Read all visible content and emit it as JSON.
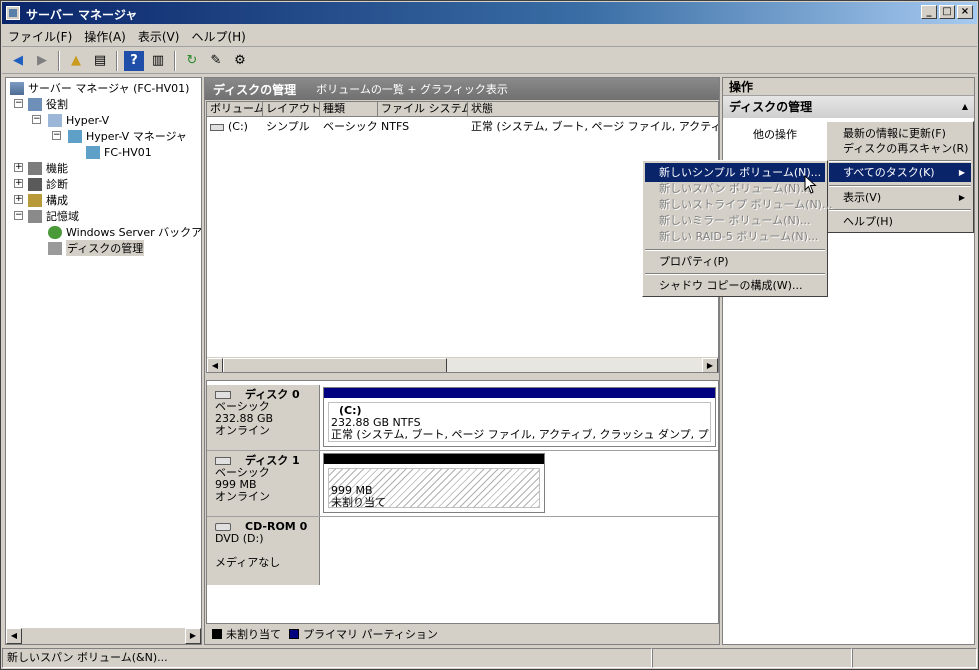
{
  "window": {
    "title": "サーバー マネージャ",
    "min": "_",
    "max": "□",
    "close": "×"
  },
  "menu": [
    "ファイル(F)",
    "操作(A)",
    "表示(V)",
    "ヘルプ(H)"
  ],
  "tree": {
    "items": [
      {
        "label": "サーバー マネージャ (FC-HV01)"
      },
      {
        "label": "役割"
      },
      {
        "label": "Hyper-V"
      },
      {
        "label": "Hyper-V マネージャ"
      },
      {
        "label": "FC-HV01"
      },
      {
        "label": "機能"
      },
      {
        "label": "診断"
      },
      {
        "label": "構成"
      },
      {
        "label": "記憶域"
      },
      {
        "label": "Windows Server バックアップ"
      },
      {
        "label": "ディスクの管理"
      }
    ]
  },
  "center": {
    "title": "ディスクの管理",
    "subtitle": "ボリュームの一覧 + グラフィック表示",
    "columns": [
      "ボリューム",
      "レイアウト",
      "種類",
      "ファイル システム",
      "状態"
    ],
    "rows": [
      {
        "volume": "(C:)",
        "layout": "シンプル",
        "type": "ベーシック",
        "fs": "NTFS",
        "status": "正常 (システム, ブート, ページ ファイル, アクティブ, クラッシュ ダンプ, プライマリ パーティション)"
      }
    ],
    "disks": [
      {
        "name": "ディスク 0",
        "type": "ベーシック",
        "size": "232.88 GB",
        "state": "オンライン",
        "partition": {
          "label": "(C:)",
          "size": "232.88 GB NTFS",
          "status": "正常 (システム, ブート, ページ ファイル, アクティブ, クラッシュ ダンプ, プライマリ パーティション)"
        }
      },
      {
        "name": "ディスク 1",
        "type": "ベーシック",
        "size": "999 MB",
        "state": "オンライン",
        "partition": {
          "size": "999 MB",
          "status": "未割り当て"
        }
      },
      {
        "name": "CD-ROM 0",
        "type": "DVD (D:)",
        "size": "",
        "state": "メディアなし"
      }
    ],
    "legend": [
      {
        "label": "未割り当て",
        "color": "#000000"
      },
      {
        "label": "プライマリ パーティション",
        "color": "#000080"
      }
    ]
  },
  "actions": {
    "title": "操作",
    "section": "ディスクの管理",
    "other": "他の操作"
  },
  "submenu": {
    "items": [
      "最新の情報に更新(F)",
      "ディスクの再スキャン(R)",
      "すべてのタスク(K)",
      "表示(V)",
      "ヘルプ(H)"
    ]
  },
  "contextmenu": {
    "items": [
      "新しいシンプル ボリューム(N)...",
      "新しいスパン ボリューム(N)...",
      "新しいストライプ ボリューム(N)...",
      "新しいミラー ボリューム(N)...",
      "新しい RAID-5 ボリューム(N)...",
      "プロパティ(P)",
      "シャドウ コピーの構成(W)..."
    ]
  },
  "status": {
    "text": "新しいスパン ボリューム(&N)..."
  },
  "colors": {
    "accent": "#0a246a",
    "primary_partition": "#000080",
    "unallocated": "#000000"
  }
}
